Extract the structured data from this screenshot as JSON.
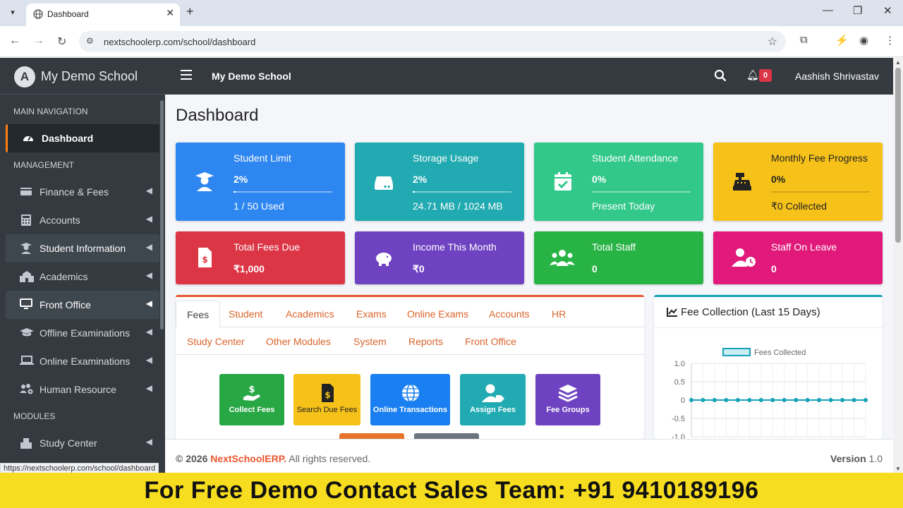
{
  "browser": {
    "tab_title": "Dashboard",
    "url": "nextschoolerp.com/school/dashboard",
    "status_url": "https://nextschoolerp.com/school/dashboard"
  },
  "sidebar": {
    "brand": "My Demo School",
    "logo_letter": "A",
    "sections": {
      "main": "MAIN NAVIGATION",
      "management": "MANAGEMENT",
      "modules": "MODULES"
    },
    "items": [
      {
        "label": "Dashboard",
        "icon": "tachometer-icon"
      },
      {
        "label": "Finance & Fees",
        "icon": "money-icon"
      },
      {
        "label": "Accounts",
        "icon": "calculator-icon"
      },
      {
        "label": "Student Information",
        "icon": "user-graduate-icon"
      },
      {
        "label": "Academics",
        "icon": "school-icon"
      },
      {
        "label": "Front Office",
        "icon": "desktop-icon"
      },
      {
        "label": "Offline Examinations",
        "icon": "graduation-cap-icon"
      },
      {
        "label": "Online Examinations",
        "icon": "laptop-icon"
      },
      {
        "label": "Human Resource",
        "icon": "users-cog-icon"
      },
      {
        "label": "Study Center",
        "icon": "building-icon"
      }
    ]
  },
  "topnav": {
    "school": "My Demo School",
    "notifications": "0",
    "user": "Aashish Shrivastav"
  },
  "page_title": "Dashboard",
  "info_boxes": [
    {
      "title": "Student Limit",
      "value": "2%",
      "detail": "1 / 50 Used",
      "progress": 0.02,
      "color": "#2e86f0"
    },
    {
      "title": "Storage Usage",
      "value": "2%",
      "detail": "24.71 MB / 1024 MB",
      "progress": 0.02,
      "color": "#21aab1"
    },
    {
      "title": "Student Attendance",
      "value": "0%",
      "detail": "Present Today",
      "progress": 0,
      "color": "#32c88a"
    },
    {
      "title": "Monthly Fee Progress",
      "value": "0%",
      "detail": "₹0 Collected",
      "progress": 0,
      "color": "#f6c21a"
    },
    {
      "title": "Total Fees Due",
      "value": "₹1,000",
      "color": "#dc3545"
    },
    {
      "title": "Income This Month",
      "value": "₹0",
      "color": "#6f42c1"
    },
    {
      "title": "Total Staff",
      "value": "0",
      "color": "#28b445"
    },
    {
      "title": "Staff On Leave",
      "value": "0",
      "color": "#e0197a"
    }
  ],
  "module_tabs": {
    "row1": [
      "Fees",
      "Student",
      "Academics",
      "Exams",
      "Online Exams",
      "Accounts",
      "HR"
    ],
    "row2": [
      "Study Center",
      "Other Modules",
      "System",
      "Reports",
      "Front Office"
    ]
  },
  "quick_buttons": [
    {
      "label": "Collect Fees",
      "color": "#28a745",
      "icon": "hand-money-icon"
    },
    {
      "label": "Search Due Fees",
      "color": "#f6c21a",
      "icon": "invoice-dollar-icon"
    },
    {
      "label": "Online Transactions",
      "color": "#1a7ff0",
      "icon": "globe-icon"
    },
    {
      "label": "Assign Fees",
      "color": "#21aab1",
      "icon": "user-tag-icon"
    },
    {
      "label": "Fee Groups",
      "color": "#6f42c1",
      "icon": "layers-icon"
    }
  ],
  "chart_card_title": "Fee Collection (Last 15 Days)",
  "chart_data": {
    "type": "line",
    "series": [
      {
        "name": "Fees Collected",
        "values": [
          0,
          0,
          0,
          0,
          0,
          0,
          0,
          0,
          0,
          0,
          0,
          0,
          0,
          0,
          0,
          0
        ]
      }
    ],
    "yticks": [
      "1.0",
      "0.5",
      "0",
      "-0.5",
      "-1.0"
    ],
    "ylim": [
      -1,
      1
    ],
    "color": "#17a2b8",
    "legend": "top"
  },
  "footer": {
    "year": "© 2026",
    "brand": "NextSchoolERP.",
    "rights": "All rights reserved.",
    "version_label": "Version",
    "version": "1.0"
  },
  "promo": "For Free Demo Contact Sales Team: +91 9410189196"
}
